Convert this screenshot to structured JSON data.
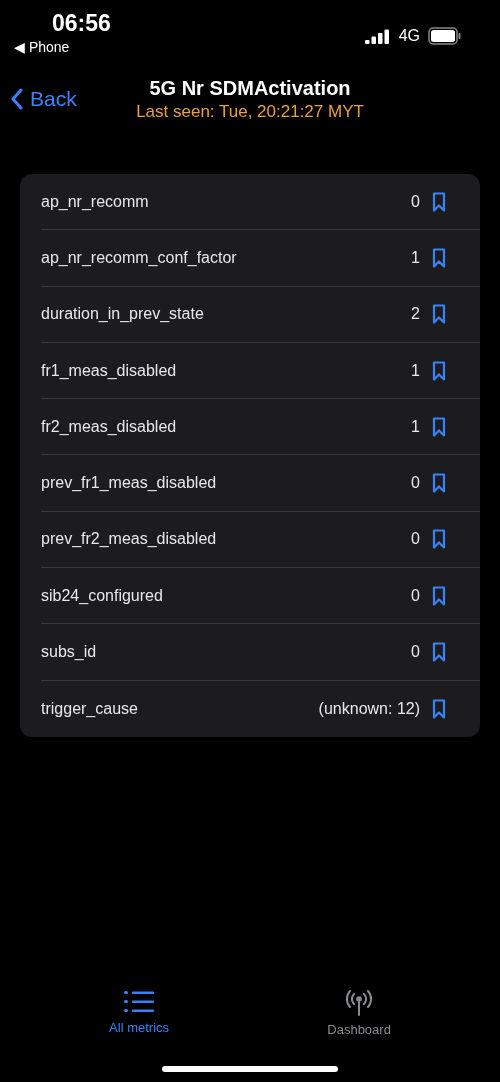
{
  "status_bar": {
    "time": "06:56",
    "back_app": "◀ Phone",
    "network": "4G"
  },
  "nav": {
    "back": "Back",
    "title": "5G Nr SDMActivation",
    "subtitle": "Last seen: Tue, 20:21:27 MYT"
  },
  "metrics": [
    {
      "name": "ap_nr_recomm",
      "value": "0"
    },
    {
      "name": "ap_nr_recomm_conf_factor",
      "value": "1"
    },
    {
      "name": "duration_in_prev_state",
      "value": "2"
    },
    {
      "name": "fr1_meas_disabled",
      "value": "1"
    },
    {
      "name": "fr2_meas_disabled",
      "value": "1"
    },
    {
      "name": "prev_fr1_meas_disabled",
      "value": "0"
    },
    {
      "name": "prev_fr2_meas_disabled",
      "value": "0"
    },
    {
      "name": "sib24_configured",
      "value": "0"
    },
    {
      "name": "subs_id",
      "value": "0"
    },
    {
      "name": "trigger_cause",
      "value": "(unknown: 12)"
    }
  ],
  "tab_bar": [
    {
      "label": "All metrics",
      "kind": "list",
      "selected": true
    },
    {
      "label": "Dashboard",
      "kind": "antenna",
      "selected": false
    }
  ]
}
